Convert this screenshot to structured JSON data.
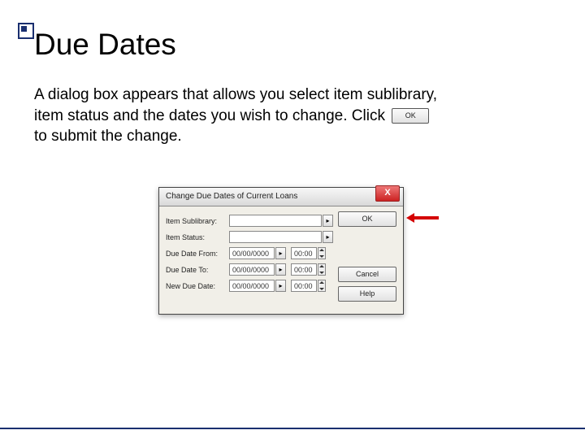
{
  "title": "Due Dates",
  "paragraph": {
    "line1": "A dialog box appears that allows you select item sublibrary,",
    "line2a": "item status and the dates you wish to change.  Click",
    "line2b": "",
    "line3": "to submit the change."
  },
  "inline_ok_label": "OK",
  "dialog": {
    "title": "Change Due Dates of Current Loans",
    "close_glyph": "X",
    "fields": {
      "sublibrary": {
        "label": "Item Sublibrary:",
        "value": ""
      },
      "status": {
        "label": "Item Status:",
        "value": ""
      },
      "from": {
        "label": "Due Date From:",
        "date": "00/00/0000",
        "time": "00:00"
      },
      "to": {
        "label": "Due Date To:",
        "date": "00/00/0000",
        "time": "00:00"
      },
      "new": {
        "label": "New Due Date:",
        "date": "00/00/0000",
        "time": "00:00"
      }
    },
    "buttons": {
      "ok": "OK",
      "cancel": "Cancel",
      "help": "Help"
    },
    "drop_glyph": "▸"
  }
}
